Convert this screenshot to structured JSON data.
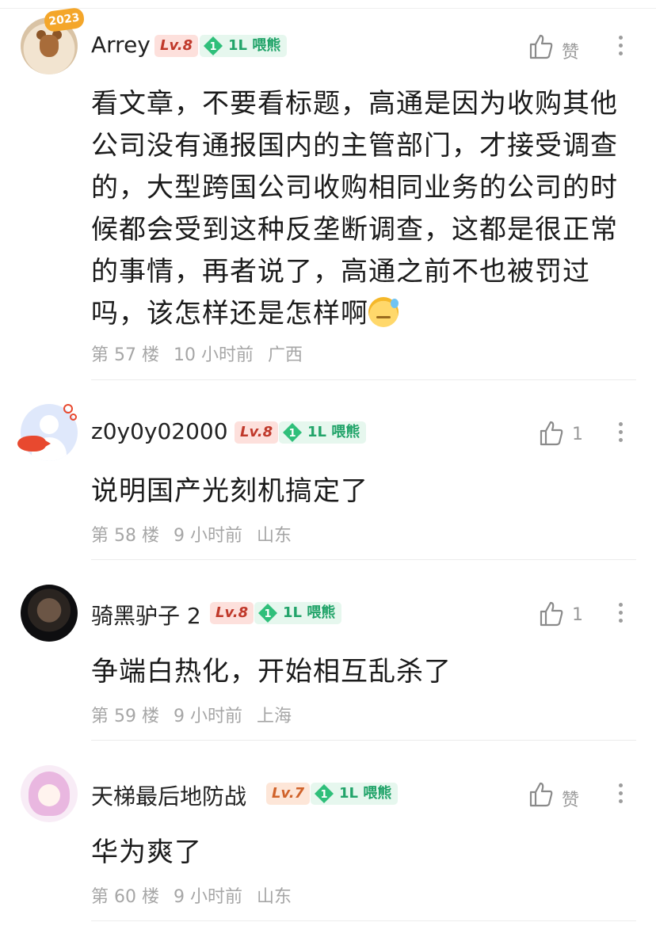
{
  "comments": [
    {
      "username": "Arrey",
      "level": "Lv.8",
      "fan_number": "1",
      "fan_label": "1L 喂熊",
      "like_text": "赞",
      "avatar_badge": "2023",
      "text": "看文章，不要看标题，高通是因为收购其他公司没有通报国内的主管部门，才接受调查的，大型跨国公司收购相同业务的公司的时候都会受到这种反垄断调查，这都是很正常的事情，再者说了，高通之前不也被罚过吗，该怎样还是怎样啊",
      "emoji": "cold-sweat-emoji",
      "floor": "第 57 楼",
      "time": "10 小时前",
      "location": "广西"
    },
    {
      "username": "z0y0y02000",
      "level": "Lv.8",
      "fan_number": "1",
      "fan_label": "1L 喂熊",
      "like_text": "1",
      "text": "说明国产光刻机搞定了",
      "floor": "第 58 楼",
      "time": "9 小时前",
      "location": "山东"
    },
    {
      "username": "骑黑驴子 2",
      "level": "Lv.8",
      "fan_number": "1",
      "fan_label": "1L 喂熊",
      "like_text": "1",
      "text": "争端白热化，开始相互乱杀了",
      "floor": "第 59 楼",
      "time": "9 小时前",
      "location": "上海"
    },
    {
      "username": "天梯最后地防战",
      "level": "Lv.7",
      "fan_number": "1",
      "fan_label": "1L 喂熊",
      "like_text": "赞",
      "text": "华为爽了",
      "floor": "第 60 楼",
      "time": "9 小时前",
      "location": "山东"
    }
  ],
  "colors": {
    "level_bg": "#fde0dc",
    "level_text": "#c0392b",
    "fan_bg": "#e6f7ee",
    "fan_text": "#22a46a",
    "meta_text": "#a6a6a6"
  }
}
